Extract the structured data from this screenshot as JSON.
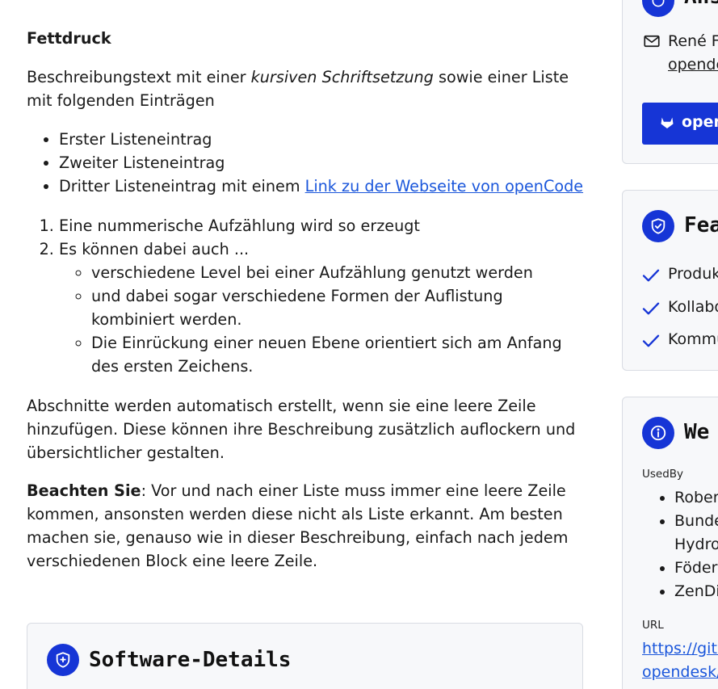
{
  "description": {
    "bold_heading": "Fettdruck",
    "para1_before": "Beschreibungstext mit einer ",
    "para1_italic": "kursiven Schriftsetzung",
    "para1_after": " sowie einer Liste mit folgenden Einträgen",
    "bullet_list": [
      "Erster Listeneintrag",
      "Zweiter Listeneintrag",
      "Dritter Listeneintrag mit einem "
    ],
    "bullet_link_text": "Link zu der Webseite von openCode",
    "numbered_list": [
      "Eine nummerische Aufzählung wird so erzeugt",
      "Es können dabei auch ..."
    ],
    "sub_list": [
      "verschiedene Level bei einer Aufzählung genutzt werden",
      "und dabei sogar verschiedene Formen der Auflistung kombiniert werden.",
      "Die Einrückung einer neuen Ebene orientiert sich am Anfang des ersten Zeichens."
    ],
    "para2": "Abschnitte werden automatisch erstellt, wenn sie eine leere Zeile hinzufügen. Diese können ihre Beschreibung zusätzlich auflockern und übersichtlicher gestalten.",
    "para3_bold": "Beachten Sie",
    "para3_rest": ": Vor und nach einer Liste muss immer eine leere Zeile kommen, ansonsten werden diese nicht als Liste erkannt. Am besten machen sie, genauso wie in dieser Beschreibung, einfach nach jedem verschiedenen Block eine leere Zeile."
  },
  "details_card": {
    "title": "Software-Details"
  },
  "sidebar": {
    "contact": {
      "title": "Ans",
      "contact_name": "René Fi",
      "contact_link": "opende",
      "button_label": "open"
    },
    "features": {
      "title": "Fea",
      "items": [
        "Produk",
        "Kollabo",
        "Kommu"
      ]
    },
    "info": {
      "title": "We",
      "usedby_label": "UsedBy",
      "usedby_items": [
        "Rober",
        "Bunde",
        "Hydro",
        "Födera",
        "ZenDi"
      ],
      "url_label": "URL",
      "url_line1": "https://gitl",
      "url_line2": "opendesk/"
    }
  },
  "colors": {
    "accent": "#1635d6",
    "link": "#1a56db",
    "card_bg": "#f7f8fa",
    "card_border": "#d9dce3"
  }
}
